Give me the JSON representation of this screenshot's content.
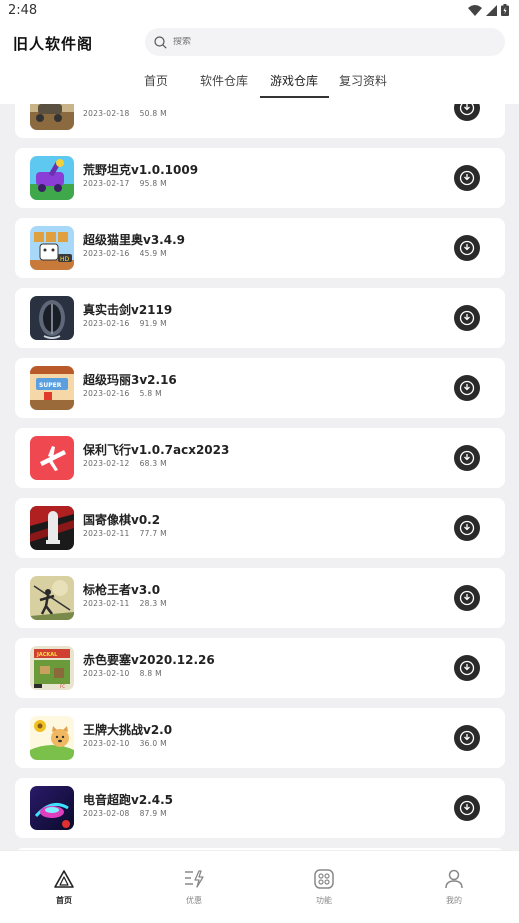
{
  "status": {
    "time": "2:48"
  },
  "header": {
    "title": "旧人软件阁",
    "search_placeholder": "搜索"
  },
  "tabs": [
    {
      "label": "首页"
    },
    {
      "label": "软件仓库"
    },
    {
      "label": "游戏仓库",
      "active": true
    },
    {
      "label": "复习资料"
    }
  ],
  "apps": [
    {
      "name": "",
      "date": "2023-02-18",
      "size": "50.8  M",
      "icon": "tank-brown"
    },
    {
      "name": "荒野坦克v1.0.1009",
      "date": "2023-02-17",
      "size": "95.8  M",
      "icon": "tank-purple"
    },
    {
      "name": "超级猫里奥v3.4.9",
      "date": "2023-02-16",
      "size": "45.9  M",
      "icon": "cat-mario"
    },
    {
      "name": "真实击剑v2119",
      "date": "2023-02-16",
      "size": "91.9  M",
      "icon": "fencing-mask"
    },
    {
      "name": "超级玛丽3v2.16",
      "date": "2023-02-16",
      "size": "5.8  M",
      "icon": "mario-3"
    },
    {
      "name": "保利飞行v1.0.7acx2023",
      "date": "2023-02-12",
      "size": "68.3  M",
      "icon": "plane-red"
    },
    {
      "name": "国寄像棋v0.2",
      "date": "2023-02-11",
      "size": "77.7  M",
      "icon": "chess-red"
    },
    {
      "name": "标枪王者v3.0",
      "date": "2023-02-11",
      "size": "28.3  M",
      "icon": "javelin"
    },
    {
      "name": "赤色要塞v2020.12.26",
      "date": "2023-02-10",
      "size": "8.8  M",
      "icon": "jackal"
    },
    {
      "name": "王牌大挑战v2.0",
      "date": "2023-02-10",
      "size": "36.0  M",
      "icon": "dog-challenge"
    },
    {
      "name": "电音超跑v2.4.5",
      "date": "2023-02-08",
      "size": "87.9  M",
      "icon": "neon-car"
    }
  ],
  "bottom_nav": [
    {
      "label": "首页",
      "icon": "home-triangle-icon",
      "active": true
    },
    {
      "label": "优惠",
      "icon": "discount-icon"
    },
    {
      "label": "功能",
      "icon": "function-icon"
    },
    {
      "label": "我的",
      "icon": "profile-icon"
    }
  ],
  "colors": {
    "background": "#f0f0f2",
    "card": "#ffffff",
    "download_button": "#2a2a2a"
  }
}
